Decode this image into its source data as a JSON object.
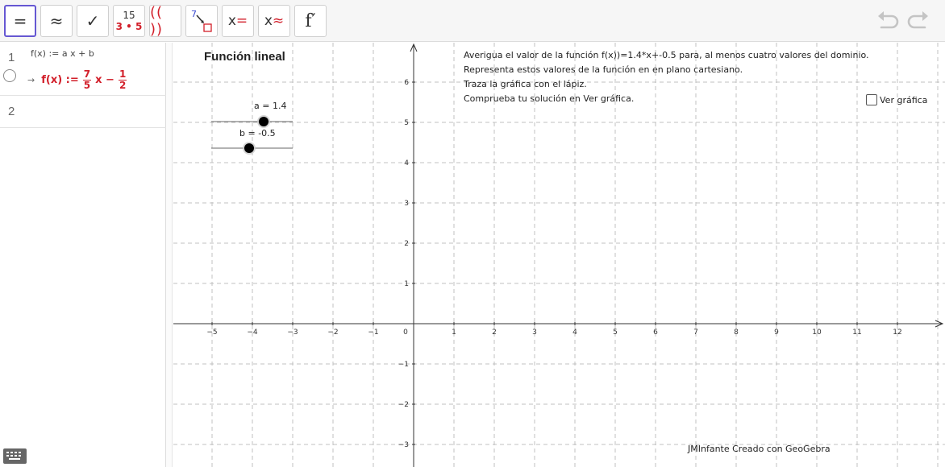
{
  "toolbar": {
    "tools": [
      {
        "name": "evaluate-tool",
        "glyph": "=",
        "active": true
      },
      {
        "name": "numeric-tool",
        "glyph": "≈"
      },
      {
        "name": "keep-input-tool",
        "glyph": "✓"
      },
      {
        "name": "factor-number-tool",
        "top": "15",
        "bottom": "3 • 5"
      },
      {
        "name": "expand-tool",
        "glyph": "(( ))"
      },
      {
        "name": "substitute-tool",
        "glyph": "7"
      },
      {
        "name": "solve-tool",
        "glyph": "x",
        "accent": "="
      },
      {
        "name": "solve-numerically-tool",
        "glyph": "x",
        "accent": "≈"
      },
      {
        "name": "derivative-tool",
        "glyph": "f′"
      }
    ],
    "undo_icon": "undo-icon",
    "redo_icon": "redo-icon"
  },
  "algebra": {
    "rows": [
      {
        "number": "1",
        "definition": "f(x) := a x + b",
        "output_prefix": "f(x) :=",
        "frac_a_num": "7",
        "frac_a_den": "5",
        "middle": "x −",
        "frac_b_num": "1",
        "frac_b_den": "2"
      },
      {
        "number": "2"
      }
    ],
    "keyboard_icon": "keyboard-icon"
  },
  "graphics": {
    "title": "Función lineal",
    "instructions": [
      "Averigua el valor de la función f(x))=1.4*x+-0.5 para, al menos cuatro valores del dominio.",
      "Representa estos valores de la función en en plano cartesiano.",
      "Traza la gráfica con el lápiz.",
      "Comprueba tu solución en Ver gráfica."
    ],
    "checkbox_label": "Ver gráfica",
    "checkbox_checked": false,
    "slider_a_label": "a = 1.4",
    "slider_b_label": "b = -0.5",
    "credit": "JMInfante Creado con GeoGebra",
    "x_tick_labels": [
      "−5",
      "−4",
      "−3",
      "−2",
      "−1",
      "0",
      "1",
      "2",
      "3",
      "4",
      "5",
      "6",
      "7",
      "8",
      "9",
      "10",
      "11",
      "12"
    ],
    "y_tick_labels": [
      "6",
      "5",
      "4",
      "3",
      "2",
      "1",
      "−1",
      "−2",
      "−3"
    ],
    "accent_color": "#6557d2",
    "function_color": "#d21f2a"
  }
}
